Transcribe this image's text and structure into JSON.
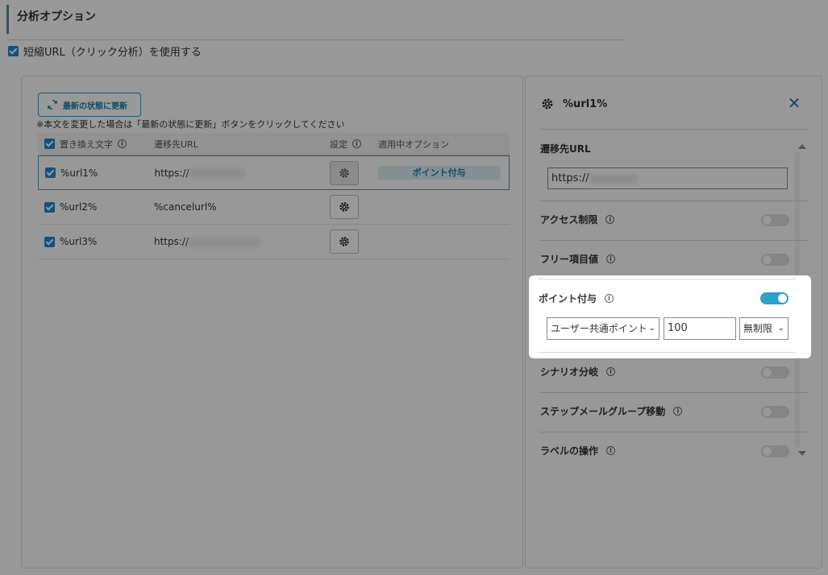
{
  "section": {
    "title": "分析オプション",
    "short_url_label": "短縮URL（クリック分析）を使用する"
  },
  "left": {
    "refresh_label": "最新の状態に更新",
    "notice": "※本文を変更した場合は「最新の状態に更新」ボタンをクリックしてください",
    "headers": {
      "replace": "置き換え文字",
      "url": "遷移先URL",
      "settings": "設定",
      "options": "適用中オプション"
    },
    "rows": [
      {
        "key": "%url1%",
        "url": "https://",
        "option": "ポイント付与"
      },
      {
        "key": "%url2%",
        "url": "%cancelurl%",
        "option": ""
      },
      {
        "key": "%url3%",
        "url": "https://",
        "option": ""
      }
    ]
  },
  "right": {
    "title": "%url1%",
    "url_label": "遷移先URL",
    "url_value": "https://",
    "options": [
      {
        "label": "アクセス制限",
        "on": false
      },
      {
        "label": "フリー項目値",
        "on": false
      },
      {
        "label": "ポイント付与",
        "on": true
      },
      {
        "label": "シナリオ分岐",
        "on": false
      },
      {
        "label": "ステップメールグループ移動",
        "on": false
      },
      {
        "label": "ラベルの操作",
        "on": false
      }
    ],
    "point": {
      "type_selected": "ユーザー共通ポイント",
      "amount": "100",
      "limit_selected": "無制限"
    }
  },
  "colors": {
    "accent": "#1d7fa6",
    "toggle_on": "#2a9fd0",
    "checkbox": "#1e88d0"
  }
}
